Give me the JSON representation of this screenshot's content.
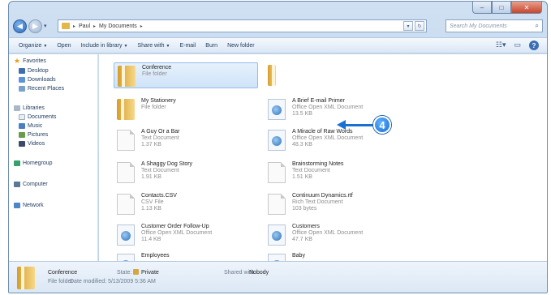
{
  "window": {
    "controls": {
      "minimize": "–",
      "maximize": "□",
      "close": "✕"
    }
  },
  "address": {
    "path": [
      "Paul",
      "My Documents"
    ],
    "search_placeholder": "Search My Documents"
  },
  "toolbar": {
    "organize": "Organize",
    "open": "Open",
    "include": "Include in library",
    "share": "Share with",
    "email": "E-mail",
    "burn": "Burn",
    "new_folder": "New folder"
  },
  "nav": {
    "favorites": "Favorites",
    "desktop": "Desktop",
    "downloads": "Downloads",
    "recent": "Recent Places",
    "libraries": "Libraries",
    "documents": "Documents",
    "music": "Music",
    "pictures": "Pictures",
    "videos": "Videos",
    "homegroup": "Homegroup",
    "computer": "Computer",
    "network": "Network"
  },
  "files": [
    {
      "name": "Conference",
      "sub": "File folder",
      "sub2": ""
    },
    {
      "name": "My Stationery",
      "sub": "File folder",
      "sub2": ""
    },
    {
      "name": "A Guy Or a Bar",
      "sub": "Text Document",
      "sub2": "1.37 KB"
    },
    {
      "name": "A Shaggy Dog Story",
      "sub": "Text Document",
      "sub2": "1.91 KB"
    },
    {
      "name": "Contacts.CSV",
      "sub": "CSV File",
      "sub2": "1.13 KB"
    },
    {
      "name": "Customer Order Follow-Up",
      "sub": "Office Open XML Document",
      "sub2": "11.4 KB"
    },
    {
      "name": "Employees",
      "sub": "",
      "sub2": ""
    },
    {
      "name": "A Brief E-mail Primer",
      "sub": "Office Open XML Document",
      "sub2": "13.5 KB"
    },
    {
      "name": "A Miracle of Raw Words",
      "sub": "Office Open XML Document",
      "sub2": "48.3 KB"
    },
    {
      "name": "Brainstorming Notes",
      "sub": "Text Document",
      "sub2": "1.51 KB"
    },
    {
      "name": "Continuum Dynamics.rtf",
      "sub": "Rich Text Document",
      "sub2": "103 bytes"
    },
    {
      "name": "Customers",
      "sub": "Office Open XML Document",
      "sub2": "47.7 KB"
    },
    {
      "name": "Baby",
      "sub": "",
      "sub2": ""
    }
  ],
  "callout": {
    "number": "4"
  },
  "details": {
    "name": "Conference",
    "type": "File folder",
    "modified": "Date modified: 5/13/2009 5:36 AM",
    "state_label": "State:",
    "state_value": "Private",
    "shared_label": "Shared with:",
    "shared_value": "Nobody"
  }
}
